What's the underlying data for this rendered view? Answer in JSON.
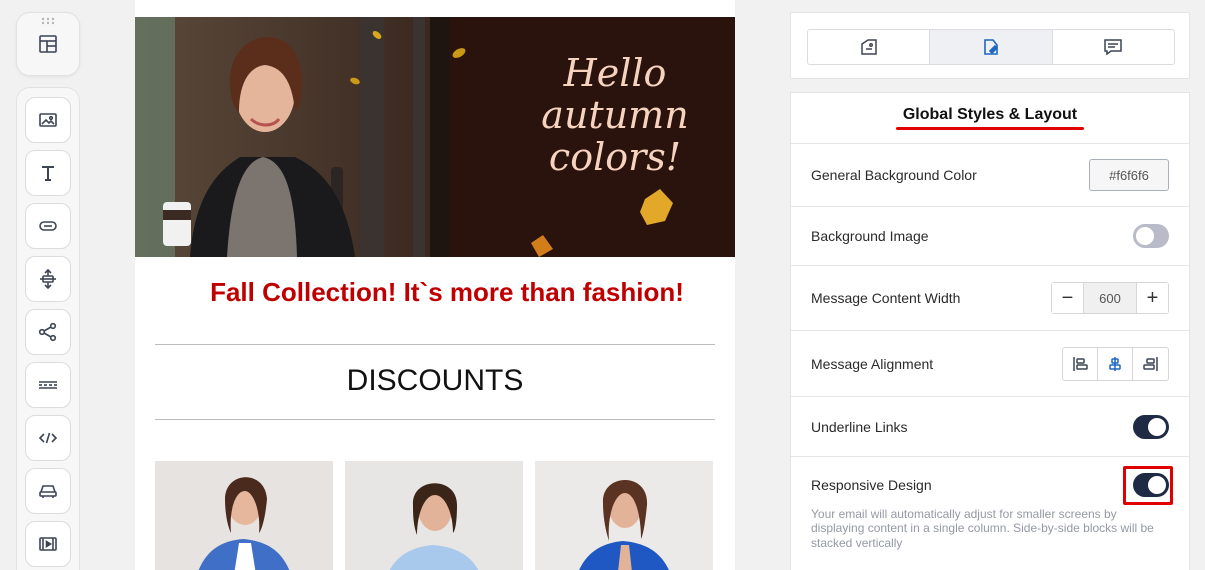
{
  "toolbar": {
    "top_icon": "layout-blocks-icon",
    "items": [
      {
        "name": "image-block-icon"
      },
      {
        "name": "text-block-icon"
      },
      {
        "name": "button-block-icon"
      },
      {
        "name": "spacer-block-icon"
      },
      {
        "name": "social-share-icon"
      },
      {
        "name": "divider-block-icon"
      },
      {
        "name": "html-code-icon"
      },
      {
        "name": "menu-block-icon"
      },
      {
        "name": "video-block-icon"
      }
    ]
  },
  "email": {
    "hero_text": "Hello autumn colors!",
    "headline": "Fall Collection! It`s more than fashion!",
    "section_title": "DISCOUNTS",
    "colors": {
      "headline": "#c00000",
      "hero_bg": "#2a130c",
      "hero_text": "#f6d3bf"
    }
  },
  "settings": {
    "tabs": [
      {
        "icon": "content-icon",
        "active": false
      },
      {
        "icon": "styles-icon",
        "active": true
      },
      {
        "icon": "comments-icon",
        "active": false
      }
    ],
    "title": "Global Styles & Layout",
    "rows": {
      "bg_color": {
        "label": "General Background Color",
        "value": "#f6f6f6"
      },
      "bg_image": {
        "label": "Background Image",
        "on": false
      },
      "content_width": {
        "label": "Message Content Width",
        "value": "600",
        "minus": "−",
        "plus": "+"
      },
      "alignment": {
        "label": "Message Alignment",
        "selected": "center"
      },
      "underline_links": {
        "label": "Underline Links",
        "on": true
      },
      "responsive": {
        "label": "Responsive Design",
        "on": true,
        "description": "Your email will automatically adjust for smaller screens by displaying content in a single column. Side-by-side blocks will be stacked vertically"
      }
    },
    "colors": {
      "accent": "#1f66c1",
      "toggle_on": "#1f2b45",
      "highlight": "#e00000"
    }
  }
}
